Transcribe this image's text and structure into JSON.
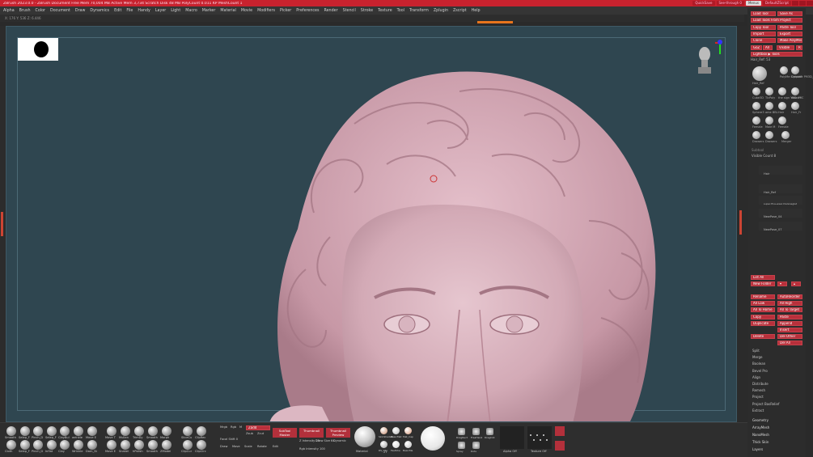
{
  "window": {
    "title": "ZBrush 2023.0.0 - ZBrush Document  Free Mem 70,004 MB  Active Mem 3,734  Scratch Disk 48 MB  PolyCount 0.011 KP  MeshCount 1",
    "quicksave": "QuickSave",
    "see_through": "See-through 0",
    "menus_btn": "Menus",
    "default_script": "DefaultZScript"
  },
  "menu": [
    "Alpha",
    "Brush",
    "Color",
    "Document",
    "Draw",
    "Dynamics",
    "Edit",
    "File",
    "Handy",
    "Layer",
    "Light",
    "Macro",
    "Marker",
    "Material",
    "Movie",
    "Modifiers",
    "Picker",
    "Preferences",
    "Render",
    "Stencil",
    "Stroke",
    "Texture",
    "Tool",
    "Transform",
    "Zplugin",
    "Zscript",
    "Help"
  ],
  "status_line": "X: 176  Y: 536  Z: 6.446",
  "colors": {
    "accent": "#c8222e",
    "orange": "#e8741c",
    "viewport": "#2f4650",
    "sculpt": "#dcb7c2"
  },
  "right_panel": {
    "buttons_top": [
      [
        "Load Tool",
        "Save As"
      ],
      [
        "Load Tools From Project",
        ""
      ],
      [
        "Copy Tool",
        "Paste Tool"
      ],
      [
        "Import",
        "Export"
      ],
      [
        "Clone",
        "Make PolyMesh3D"
      ],
      [
        "GoZ",
        "All",
        "Visible",
        "R"
      ],
      [
        "Lightbox ▶ Tools",
        ""
      ]
    ],
    "tool_name": "Hair_Ref: 53",
    "tools": [
      {
        "label": "Hair_Ref",
        "icon": "sphere-tool-icon"
      },
      {
        "label": "PolyMe SimpleB",
        "icon": "star-tool-icon"
      },
      {
        "label": "Cylinder PM3D_C",
        "icon": "cylinder-tool-icon"
      },
      {
        "label": "Cube3D",
        "icon": "cube-tool-icon"
      },
      {
        "label": "TlcPoly",
        "icon": "poly-tool-icon"
      },
      {
        "label": "the sign YBD-sm",
        "icon": "sign-tool-icon"
      },
      {
        "label": "ame FFC",
        "icon": "ame-tool-icon"
      },
      {
        "label": "Sphere3",
        "icon": "sphere3-tool-icon"
      },
      {
        "label": "ame BBL",
        "icon": "bbl-tool-icon"
      },
      {
        "label": "Hair",
        "icon": "hair-tool-icon"
      },
      {
        "label": "Hair_Fr",
        "icon": "hairfr-tool-icon"
      },
      {
        "label": "Female",
        "icon": "female-tool-icon"
      },
      {
        "label": "Male M",
        "icon": "male-tool-icon"
      },
      {
        "label": "Female",
        "icon": "female2-tool-icon"
      },
      {
        "label": "Drowers",
        "icon": "drowers-tool-icon"
      },
      {
        "label": "Drowers",
        "icon": "drowers2-tool-icon"
      },
      {
        "label": "Merger",
        "icon": "merger-tool-icon"
      }
    ],
    "subtool_header": "Subtool",
    "visible_count": "Visible Count 8",
    "subtools": [
      "Hair",
      "Hair_Ref",
      "super-fine-wear-hlelaneglet",
      "NewPose_04",
      "NewPose_07"
    ],
    "list_all": "List All",
    "new_folder": "New Folder",
    "actions": [
      [
        "Rename",
        "AutoReorder"
      ],
      [
        "All Low",
        "All High"
      ],
      [
        "All To Home",
        "All To Target"
      ],
      [
        "Copy",
        "Paste"
      ],
      [
        "Duplicate",
        "Append"
      ],
      [
        "",
        "Insert"
      ],
      [
        "Delete",
        "Del Other"
      ],
      [
        "",
        "Del All"
      ]
    ],
    "menu_list": [
      "Split",
      "Merge",
      "Boolean",
      "Bevel Pro",
      "Align",
      "Distribute",
      "Remesh",
      "Project",
      "Project BasRelief",
      "Extract"
    ],
    "sections": [
      "Geometry",
      "ArrayMesh",
      "NanoMesh",
      "Thick Skin",
      "Layers"
    ]
  },
  "bottom": {
    "brushes_top": [
      "Smooth",
      "Selep_F",
      "Pinch_D",
      "Selep_F",
      "ClayBul",
      "wrinkle",
      "Move E",
      "Move T",
      "Mullen",
      "TrimDy",
      "Smooth",
      "Morph",
      "SliceCu",
      "ClipRec"
    ],
    "brushes_bottom": [
      "Cloth",
      "Selep_F",
      "Pinch_D",
      "Inflat",
      "Clay",
      "Wrinkle",
      "Dam_St",
      "Move E",
      "Snakel",
      "hPolish",
      "Smooth",
      "ZModel",
      "ClipCur",
      "ClipCirc"
    ],
    "mrgb": [
      "Mrgb",
      "Rgb",
      "M"
    ],
    "zadd": "Zadd",
    "zsub": "Zsub",
    "zcut": "Zcut",
    "focal_shift": "Focal Shift 0",
    "z_intensity": "Z Intensity 25",
    "draw_size": "Draw Size 64",
    "dynamic": "Dynamic",
    "rgb_intensity": "Rgb Intensity 100",
    "subtool_master": "SubTool Master",
    "thumbnail": "Thumbnail",
    "preview_ssm": "Thumbnail Preview",
    "draw_label": "Draw",
    "move_label": "Move",
    "scale_label": "Scale",
    "rotate_label": "Rotate",
    "edit_label": "Edit",
    "material": "Material",
    "material_labels": [
      "SkinShade4",
      "BasicMat",
      "Mat_Cap",
      "RS_Obj",
      "FastSha",
      "BasicMa"
    ],
    "numeric": "27",
    "stroke_labels": [
      "DragRect",
      "FreeHand",
      "DragDot",
      "Spray",
      "Dots"
    ],
    "alpha_label": "Alpha Off",
    "texture_label": "Texture Off"
  }
}
